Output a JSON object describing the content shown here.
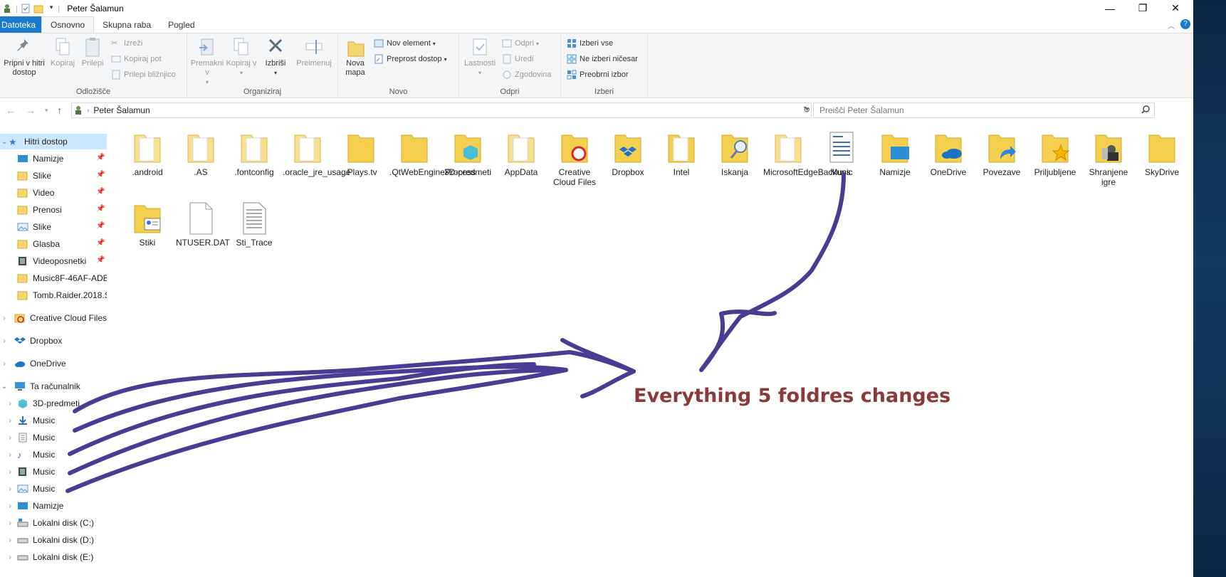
{
  "window": {
    "title": "Peter Šalamun"
  },
  "ribbon_tabs": [
    "Datoteka",
    "Osnovno",
    "Skupna raba",
    "Pogled"
  ],
  "ribbon": {
    "clipboard": {
      "label": "Odložišče",
      "pin_label": "Pripni v hitri dostop",
      "copy_label": "Kopiraj",
      "paste_label": "Prilepi",
      "cut_label": "Izreži",
      "copy_path_label": "Kopiraj pot",
      "paste_shortcut_label": "Prilepi bližnjico"
    },
    "organize": {
      "label": "Organiziraj",
      "move_label": "Premakni v",
      "copyto_label": "Kopiraj v",
      "delete_label": "Izbriši",
      "rename_label": "Preimenuj"
    },
    "new": {
      "label": "Novo",
      "new_folder_label": "Nova mapa",
      "new_item_label": "Nov element",
      "easy_access_label": "Preprost dostop"
    },
    "open": {
      "label": "Odpri",
      "properties_label": "Lastnosti",
      "open_label": "Odpri",
      "edit_label": "Uredi",
      "history_label": "Zgodovina"
    },
    "select": {
      "label": "Izberi",
      "select_all_label": "Izberi vse",
      "select_none_label": "Ne izberi ničesar",
      "invert_label": "Preobrni izbor"
    }
  },
  "address": {
    "path": "Peter Šalamun",
    "search_placeholder": "Preišči Peter Šalamun"
  },
  "navpane": {
    "quick_access": "Hitri dostop",
    "quick_items": [
      "Namizje",
      "Slike",
      "Video",
      "Prenosi",
      "Slike",
      "Glasba",
      "Videoposnetki",
      "Music8F-46AF-ADB",
      "Tomb.Raider.2018.S"
    ],
    "roots": [
      "Creative Cloud Files",
      "Dropbox",
      "OneDrive",
      "Ta računalnik"
    ],
    "pc_items": [
      "3D-predmeti",
      "Music",
      "Music",
      "Music",
      "Music",
      "Music",
      "Namizje",
      "Lokalni disk (C:)",
      "Lokalni disk (D:)",
      "Lokalni disk (E:)"
    ]
  },
  "files": [
    ".android",
    ".AS",
    ".fontconfig",
    ".oracle_jre_usage",
    ".Plays.tv",
    ".QtWebEngineProcess",
    "3D-predmeti",
    "AppData",
    "Creative Cloud Files",
    "Dropbox",
    "Intel",
    "Iskanja",
    "MicrosoftEdgeBackups",
    "Music",
    "Namizje",
    "OneDrive",
    "Povezave",
    "Priljubljene",
    "Shranjene igre",
    "SkyDrive",
    "Stiki",
    "NTUSER.DAT",
    "Sti_Trace"
  ],
  "annotation": "Everything 5 foldres changes",
  "colors": {
    "accent": "#1979ca",
    "selection": "#cce8ff",
    "ink": "#4a3b8f",
    "annotation": "#8b3a3a"
  }
}
